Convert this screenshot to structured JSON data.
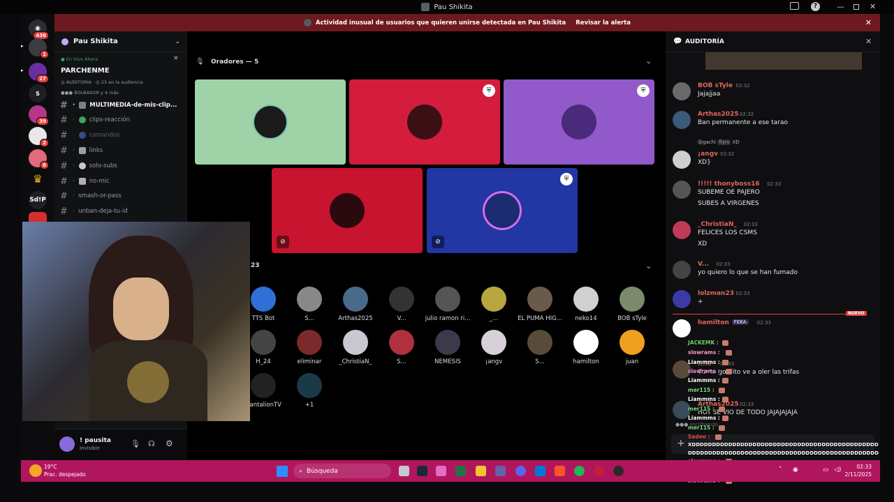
{
  "window": {
    "title": "Pau Shikita"
  },
  "alert": {
    "text": "Actividad inusual de usuarios que quieren unirse detectada en Pau Shikita",
    "action": "Revisar la alerta"
  },
  "guilds": {
    "badges": [
      "436",
      "1",
      "27",
      "2",
      "39",
      "2",
      "6"
    ],
    "labels": {
      "s": "S",
      "sdp": "Sd!P"
    }
  },
  "server": {
    "name": "Pau Shikita"
  },
  "live": {
    "status": "En Vivo Ahora",
    "stage_name": "PARCHENME",
    "audit_text": "AUDITORÍA",
    "audience": "23 en la audiencia",
    "members": "BOLBASOR y 4 más"
  },
  "channels": [
    "MULTIMEDIA-de-mis-clip...",
    "clips-reacción",
    "comandos",
    "links",
    "solo-subs",
    "no-mic",
    "smash-or-pass",
    "unban-deja-tu-id"
  ],
  "user": {
    "name": "! pausita",
    "status": "Invisible"
  },
  "speakers": {
    "header": "Oradores — 5"
  },
  "audience": {
    "count": "23",
    "members": [
      "TTS Bot",
      "S...",
      "Arthas2025",
      "V...",
      "julio ramon ri...",
      "_...",
      "EL PUMA HIG...",
      "neko14",
      "BOB sTyle",
      "H_24",
      "eliminar",
      "_ChristiaN_",
      "S...",
      "NÉMESIS",
      "¡angv",
      "S...",
      "hamilton",
      "juan",
      "DantalionTV",
      "+1"
    ]
  },
  "panel": {
    "title": "AUDITORÍA",
    "new_label": "NUEVO",
    "typing": "escribiendo..."
  },
  "messages": [
    {
      "name": "BOB sTyle",
      "time": "02:32",
      "lines": [
        "Jajajjaa"
      ]
    },
    {
      "name": "Arthas2025",
      "time": "02:32",
      "lines": [
        "Ban permanente a ese tarao"
      ]
    },
    {
      "reply_to": "@gachi",
      "reply_tag": "flyrs",
      "reply_text": "XD",
      "name": "¡angv",
      "time": "02:32",
      "lines": [
        "XD}"
      ]
    },
    {
      "name": "!!!!! thonyboss16",
      "time": "02:33",
      "lines": [
        "SUBEME OE PAJERO",
        "SUBES A VIRGENES"
      ]
    },
    {
      "name": "_ChristiaN_",
      "time": "02:33",
      "lines": [
        "FELICES LOS CSMS",
        "XD"
      ]
    },
    {
      "name": "V...",
      "time": "02:33",
      "lines": [
        "yo quiero lo que se han fumado"
      ]
    },
    {
      "name": "lolzman23",
      "time": "02:33",
      "lines": [
        "+"
      ]
    },
    {
      "name": "hamilton",
      "tag": "FEKA",
      "time": "02:33",
      "lines": []
    },
    {
      "name": "...le",
      "time": "02:33",
      "lines": [
        "Conta gordito ve a oler las trifas"
      ]
    },
    {
      "name": "Arthas2025",
      "time": "02:33",
      "lines": [
        "HOY SE VIO DE TODO JAJAJAJAJA"
      ]
    }
  ],
  "overlay_chat": [
    {
      "user": "JACKEMK :",
      "color": "#6fd36f"
    },
    {
      "user": "slowrams :",
      "color": "#ff9dd6"
    },
    {
      "user": "Liammms :",
      "color": "#ffffff"
    },
    {
      "user": "slowrams :",
      "color": "#ff9dd6"
    },
    {
      "user": "Liammms :",
      "color": "#ffffff"
    },
    {
      "user": "mer115 :",
      "color": "#7ddf7d"
    },
    {
      "user": "Liammms :",
      "color": "#ffffff"
    },
    {
      "user": "mer115 :",
      "color": "#7ddf7d"
    },
    {
      "user": "Liammms :",
      "color": "#ffffff"
    },
    {
      "user": "mer115 :",
      "color": "#7ddf7d"
    },
    {
      "user": "Sadeo :",
      "color": "#e05555"
    },
    {
      "user": "slowrams :",
      "color": "#ff9dd6"
    },
    {
      "user": "slowrams :",
      "color": "#ff9dd6"
    },
    {
      "user": "slowrams :",
      "color": "#ff9dd6"
    }
  ],
  "overlay_spam": [
    "XDDDDDDDDDDDDDDDDDDDDDDDDDDDDDDDDDDDDDDDDDDDDDDDDDDDDDDDDDDDDDDD",
    "DDDDDDDDDDDDDDDDDDDDDDDDDDDDDDDDDDDDDDDDDDDDDDDDDDDDDDDDDDDD"
  ],
  "weather": {
    "temp": "19°C",
    "desc": "Prac. despejado"
  },
  "taskbar": {
    "search": "Búsqueda"
  },
  "clock": {
    "time": "02:33",
    "date": "2/11/2025"
  }
}
